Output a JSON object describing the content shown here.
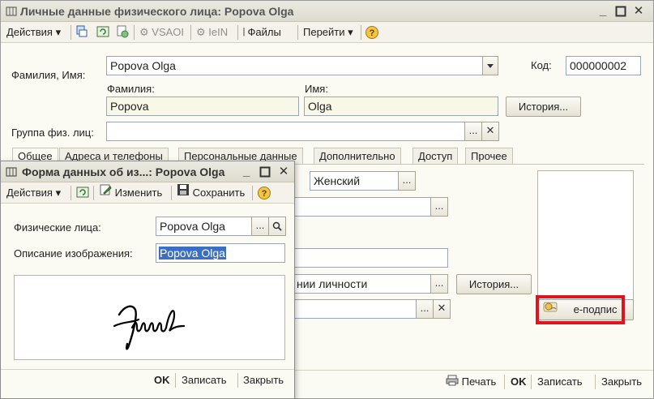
{
  "main": {
    "title": "Личные данные физического лица: Popova Olga",
    "toolbar": {
      "actions": "Действия",
      "vsaoi": "VSAOI",
      "iein": "IeIN",
      "files": "Файлы",
      "goto": "Перейти"
    },
    "form": {
      "fullname_label": "Фамилия, Имя:",
      "fullname_value": "Popova Olga",
      "code_label": "Код:",
      "code_value": "000000002",
      "lastname_label": "Фамилия:",
      "lastname_value": "Popova",
      "firstname_label": "Имя:",
      "firstname_value": "Olga",
      "history_label": "История...",
      "group_label": "Группа физ. лиц:",
      "group_value": ""
    },
    "tabs": [
      "Общее",
      "Адреса и телефоны",
      "Персональные данные",
      "Дополнительно",
      "Доступ",
      "Прочее"
    ],
    "general": {
      "gender_value": "Женский",
      "field2_value": "",
      "field3_value": "",
      "identity_value": "нии личности",
      "identity_history": "История...",
      "field5_value": "",
      "esign_label": "e-подпис"
    },
    "footer": {
      "print": "Печать",
      "ok": "OK",
      "save": "Записать",
      "close": "Закрыть"
    }
  },
  "sub": {
    "title": "Форма данных об из...: Popova Olga",
    "toolbar": {
      "actions": "Действия",
      "edit": "Изменить",
      "save": "Сохранить"
    },
    "person_label": "Физические лица:",
    "person_value": "Popova Olga",
    "desc_label": "Описание изображения:",
    "desc_value": "Popova Olga",
    "footer": {
      "ok": "OK",
      "save": "Записать",
      "close": "Закрыть"
    }
  }
}
